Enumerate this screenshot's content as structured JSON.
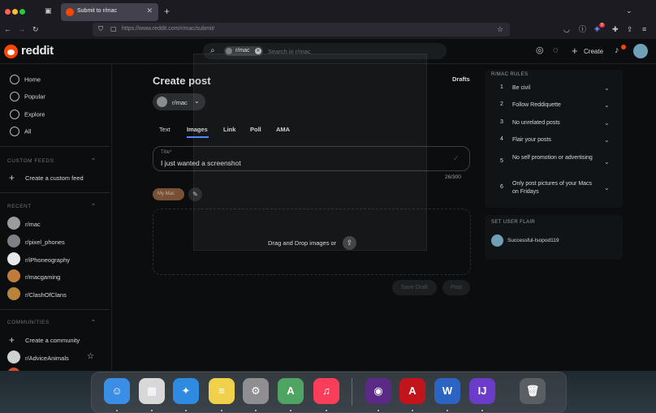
{
  "browser": {
    "tab_title": "Submit to r/mac",
    "new_tab": "+",
    "url_prefix": "https://www.reddit.com",
    "url_path": "/r/mac/submit/",
    "notification_count": "9"
  },
  "header": {
    "brand": "reddit",
    "search_chip": "r/mac",
    "search_placeholder": "Search in r/mac",
    "create_label": "Create"
  },
  "sidebar": {
    "nav": [
      {
        "label": "Home",
        "icon": "home-icon"
      },
      {
        "label": "Popular",
        "icon": "popular-icon"
      },
      {
        "label": "Explore",
        "icon": "explore-icon"
      },
      {
        "label": "All",
        "icon": "all-icon"
      }
    ],
    "custom_feeds_title": "CUSTOM FEEDS",
    "create_custom_feed": "Create a custom feed",
    "recent_title": "RECENT",
    "recent": [
      {
        "label": "r/mac",
        "color": "#9a9da0"
      },
      {
        "label": "r/pixel_phones",
        "color": "#7d8185"
      },
      {
        "label": "r/iPhoneography",
        "color": "#e8e8e8"
      },
      {
        "label": "r/macgaming",
        "color": "#c07a3a"
      },
      {
        "label": "r/ClashOfClans",
        "color": "#b8843c"
      }
    ],
    "communities_title": "COMMUNITIES",
    "create_community": "Create a community",
    "communities": [
      {
        "label": "r/AdviceAnimals",
        "color": "#d0d0d0"
      }
    ]
  },
  "main": {
    "title": "Create post",
    "drafts": "Drafts",
    "subreddit": "r/mac",
    "tabs": [
      "Text",
      "Images",
      "Link",
      "Poll",
      "AMA"
    ],
    "active_tab": "Images",
    "title_label": "Title*",
    "title_value": "I just wanted a screenshot",
    "char_count": "26/300",
    "flair_label": "My Mac",
    "drop_text": "Drag and Drop images or",
    "save_draft": "Save Draft",
    "post": "Post"
  },
  "rules": {
    "heading": "R/MAC RULES",
    "items": [
      {
        "n": "1",
        "text": "Be civil"
      },
      {
        "n": "2",
        "text": "Follow Reddiquette"
      },
      {
        "n": "3",
        "text": "No unrelated posts"
      },
      {
        "n": "4",
        "text": "Flair your posts"
      },
      {
        "n": "5",
        "text": "No self promotion or advertising"
      },
      {
        "n": "6",
        "text": "Only post pictures of your Macs on Fridays"
      }
    ]
  },
  "user_flair": {
    "heading": "SET USER FLAIR",
    "username": "Successful-Isopod119"
  },
  "dock": {
    "apps": [
      {
        "name": "finder-icon",
        "glyph": "☺",
        "color": "#3a8ee6"
      },
      {
        "name": "launchpad-icon",
        "glyph": "▦",
        "color": "#d8d8d8"
      },
      {
        "name": "safari-icon",
        "glyph": "✦",
        "color": "#2f8be0"
      },
      {
        "name": "notes-icon",
        "glyph": "≡",
        "color": "#f1d04b"
      },
      {
        "name": "system-settings-icon",
        "glyph": "⚙",
        "color": "#8e8e93"
      },
      {
        "name": "maps-icon",
        "glyph": "A",
        "color": "#4fa463"
      },
      {
        "name": "music-icon",
        "glyph": "♫",
        "color": "#fa3e5a"
      },
      {
        "name": "firefox-icon",
        "glyph": "◉",
        "color": "#5b2a86"
      },
      {
        "name": "acrobat-icon",
        "glyph": "A",
        "color": "#c3131b"
      },
      {
        "name": "word-icon",
        "glyph": "W",
        "color": "#2b64c3"
      },
      {
        "name": "intellij-icon",
        "glyph": "IJ",
        "color": "#6a3cc9"
      },
      {
        "name": "trash-icon",
        "glyph": "🗑",
        "color": "#5a5f63"
      }
    ]
  }
}
